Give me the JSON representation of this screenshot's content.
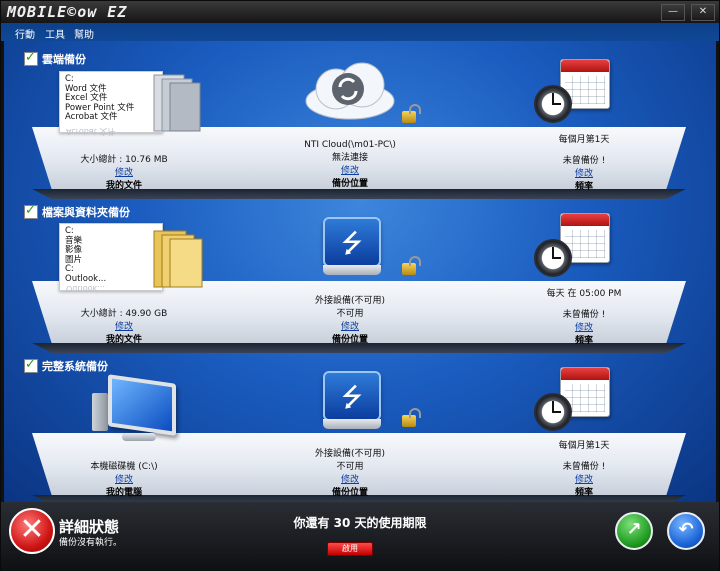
{
  "window": {
    "title_logo": "MOBILE©ow EZ",
    "controls": {
      "minimize": "—",
      "close": "✕"
    }
  },
  "menu": [
    "行動",
    "工具",
    "幫助"
  ],
  "sections": [
    {
      "header": "雲端備份",
      "files": [
        "C:",
        "Word 文件",
        "Excel 文件",
        "Power Point 文件",
        "Acrobat 文件"
      ],
      "files_reflection": "Acrobat 文件",
      "size_text": "大小總計 : 10.76 MB",
      "source_edit": "修改",
      "source_label": "我的文件",
      "dest_name": "NTI Cloud(\\m01-PC\\)",
      "dest_status": "無法連接",
      "dest_edit": "修改",
      "dest_label": "備份位置",
      "schedule": "每個月第1天",
      "schedule_status": "未曾備份 !",
      "schedule_edit": "修改",
      "schedule_label": "頻率"
    },
    {
      "header": "檔案與資料夾備份",
      "files": [
        "C:",
        "音樂",
        "影像",
        "圖片",
        "C:",
        "Outlook..."
      ],
      "files_reflection": "Outlook...",
      "size_text": "大小總計 : 49.90 GB",
      "source_edit": "修改",
      "source_label": "我的文件",
      "dest_name": "外接設備(不可用)",
      "dest_status": "不可用",
      "dest_edit": "修改",
      "dest_label": "備份位置",
      "schedule": "每天 在 05:00 PM",
      "schedule_status": "未曾備份 !",
      "schedule_edit": "修改",
      "schedule_label": "頻率"
    },
    {
      "header": "完整系統備份",
      "size_text": "本機磁碟機 (C:\\)",
      "source_edit": "修改",
      "source_label": "我的電腦",
      "dest_name": "外接設備(不可用)",
      "dest_status": "不可用",
      "dest_edit": "修改",
      "dest_label": "備份位置",
      "schedule": "每個月第1天",
      "schedule_status": "未曾備份 !",
      "schedule_edit": "修改",
      "schedule_label": "頻率"
    }
  ],
  "status": {
    "title": "詳細狀態",
    "subtitle": "備份沒有執行。",
    "trial_text": "你還有 30 天的使用期限",
    "activate_label": "啟用"
  },
  "icons": {
    "error": "✕",
    "backup_now": "↗",
    "back": "↶"
  }
}
